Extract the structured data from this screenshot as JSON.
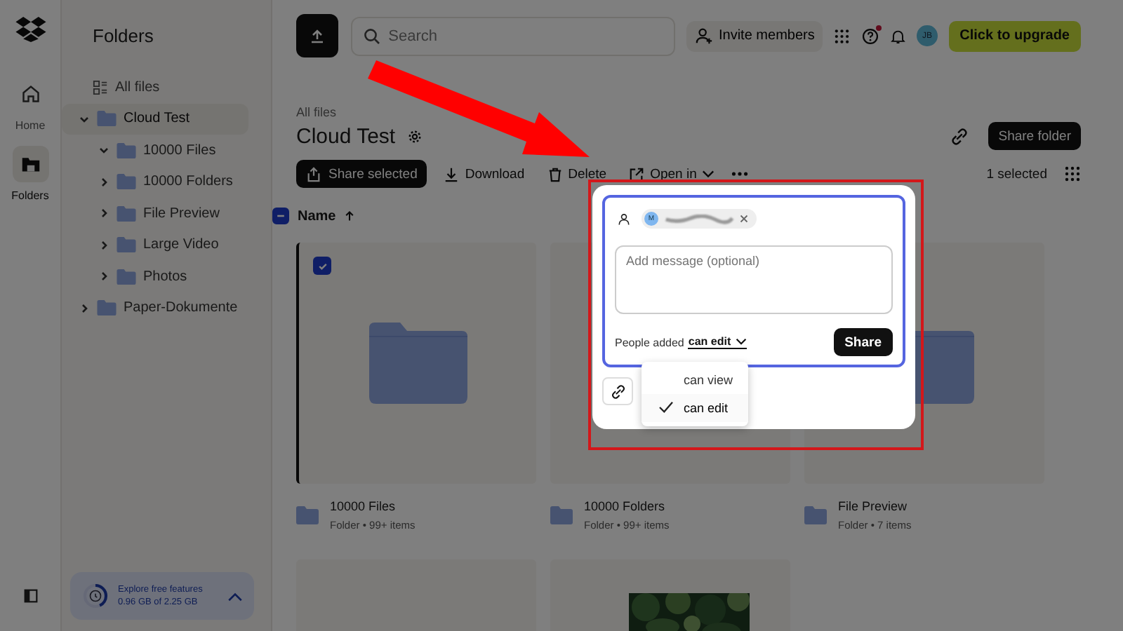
{
  "nav_rail": {
    "items": [
      {
        "kind": "home",
        "label": "Home",
        "selected": false
      },
      {
        "kind": "folders",
        "label": "Folders",
        "selected": true
      }
    ]
  },
  "sidebar": {
    "title": "Folders",
    "all_files": "All files",
    "tree": [
      {
        "label": "Cloud Test",
        "expanded": true,
        "selected": true,
        "children": [
          {
            "label": "10000 Files",
            "expanded": true,
            "selected": false
          },
          {
            "label": "10000 Folders",
            "expanded": false,
            "selected": false
          },
          {
            "label": "File Preview",
            "expanded": false,
            "selected": false
          },
          {
            "label": "Large Video",
            "expanded": false,
            "selected": false
          },
          {
            "label": "Photos",
            "expanded": false,
            "selected": false
          }
        ]
      },
      {
        "label": "Paper-Dokumente",
        "expanded": false,
        "selected": false
      }
    ],
    "storage": {
      "title": "Explore free features",
      "usage": "0.96 GB of 2.25 GB",
      "level": 0.43
    }
  },
  "topbar": {
    "search_placeholder": "Search",
    "invite": "Invite members",
    "help_badge": true,
    "avatar": "JB",
    "upgrade": "Click to upgrade"
  },
  "breadcrumb": "All files",
  "title": "Cloud Test",
  "share_folder": "Share folder",
  "actions": [
    {
      "kind": "primary",
      "label": "Share selected"
    },
    {
      "kind": "download",
      "label": "Download"
    },
    {
      "kind": "delete",
      "label": "Delete"
    },
    {
      "kind": "open",
      "label": "Open in"
    },
    {
      "kind": "more"
    }
  ],
  "selection_count": "1 selected",
  "sort": {
    "label": "Name",
    "ascending": true,
    "header_checkbox": {
      "indeterminate": true
    }
  },
  "items": [
    {
      "kind": "folder",
      "name": "10000 Files",
      "meta": "Folder • 99+ items",
      "selected": true
    },
    {
      "kind": "folder",
      "name": "10000 Folders",
      "meta": "Folder • 99+ items",
      "selected": false
    },
    {
      "kind": "folder",
      "name": "File Preview",
      "meta": "Folder • 7 items",
      "selected": false
    },
    {
      "kind": "blank",
      "selected": false
    },
    {
      "kind": "picture",
      "selected": false
    }
  ],
  "share_dialog": {
    "recipient_initial": "M",
    "message_placeholder": "Add message (optional)",
    "permission_label": "People added",
    "permission": "can edit",
    "share_button": "Share",
    "menu": [
      {
        "label": "can view",
        "selected": false
      },
      {
        "label": "can edit",
        "selected": true
      }
    ]
  },
  "annotations": {
    "arrow": true,
    "frame": true
  }
}
